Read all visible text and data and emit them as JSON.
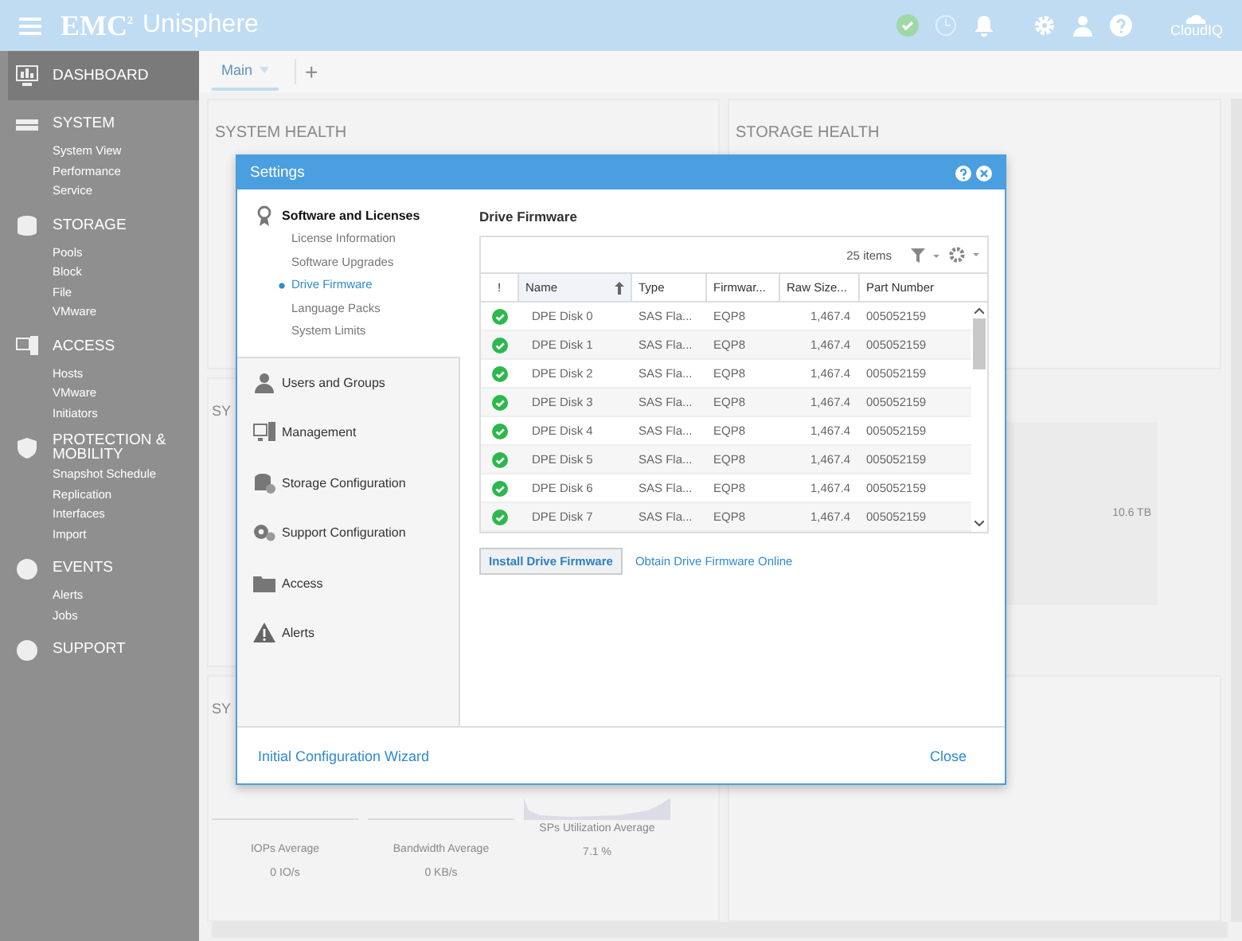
{
  "header": {
    "logo": "EMC$^{2}$",
    "product": "Unisphere",
    "cloud_label": "CloudIQ"
  },
  "sidebar": {
    "sections": [
      {
        "label": "DASHBOARD",
        "selected": true
      },
      {
        "label": "SYSTEM",
        "selected": false,
        "items": [
          "System View",
          "Performance",
          "Service"
        ]
      },
      {
        "label": "STORAGE",
        "selected": false,
        "items": [
          "Pools",
          "Block",
          "File",
          "VMware"
        ]
      },
      {
        "label": "ACCESS",
        "selected": false,
        "items": [
          "Hosts",
          "VMware",
          "Initiators"
        ]
      },
      {
        "label": "PROTECTION & MOBILITY",
        "selected": false,
        "items": [
          "Snapshot Schedule",
          "Replication",
          "Interfaces",
          "Import"
        ]
      },
      {
        "label": "EVENTS",
        "selected": false,
        "items": [
          "Alerts",
          "Jobs"
        ]
      },
      {
        "label": "SUPPORT",
        "selected": false
      }
    ]
  },
  "tabs": [
    {
      "label": "Main",
      "selected": true
    },
    {
      "label": "+",
      "selected": false
    }
  ],
  "dashboard": {
    "system_health": "SYSTEM HEALTH",
    "storage_health": "STORAGE HEALTH",
    "panel_2_title": "SY",
    "panel_3_title": "SY",
    "capacity_value": "10.6 TB",
    "stats": [
      {
        "label": "IOPs Average",
        "value": "0 IO/s"
      },
      {
        "label": "Bandwidth Average",
        "value": "0 KB/s"
      },
      {
        "label": "SPs Utilization Average",
        "value": "7.1 %"
      }
    ]
  },
  "dialog": {
    "title": "Settings",
    "nav": [
      {
        "label": "Software and Licenses",
        "expanded": true,
        "children": [
          {
            "label": "License Information",
            "selected": false
          },
          {
            "label": "Software Upgrades",
            "selected": false
          },
          {
            "label": "Drive Firmware",
            "selected": true
          },
          {
            "label": "Language Packs",
            "selected": false
          },
          {
            "label": "System Limits",
            "selected": false
          }
        ]
      },
      {
        "label": "Users and Groups",
        "expanded": false
      },
      {
        "label": "Management",
        "expanded": false
      },
      {
        "label": "Storage Configuration",
        "expanded": false
      },
      {
        "label": "Support Configuration",
        "expanded": false
      },
      {
        "label": "Access",
        "expanded": false
      },
      {
        "label": "Alerts",
        "expanded": false
      }
    ],
    "section_title": "Drive Firmware",
    "table": {
      "item_count": "25 items",
      "columns": [
        {
          "label": "!",
          "sorted": false
        },
        {
          "label": "Name",
          "sorted": true
        },
        {
          "label": "Type",
          "sorted": false
        },
        {
          "label": "Firmwar...",
          "sorted": false
        },
        {
          "label": "Raw Size...",
          "sorted": false
        },
        {
          "label": "Part Number",
          "sorted": false
        }
      ],
      "rows": [
        {
          "cells": [
            "",
            "DPE Disk 0",
            "SAS Fla...",
            "EQP8",
            "1,467.4",
            "005052159"
          ]
        },
        {
          "cells": [
            "",
            "DPE Disk 1",
            "SAS Fla...",
            "EQP8",
            "1,467.4",
            "005052159"
          ]
        },
        {
          "cells": [
            "",
            "DPE Disk 2",
            "SAS Fla...",
            "EQP8",
            "1,467.4",
            "005052159"
          ]
        },
        {
          "cells": [
            "",
            "DPE Disk 3",
            "SAS Fla...",
            "EQP8",
            "1,467.4",
            "005052159"
          ]
        },
        {
          "cells": [
            "",
            "DPE Disk 4",
            "SAS Fla...",
            "EQP8",
            "1,467.4",
            "005052159"
          ]
        },
        {
          "cells": [
            "",
            "DPE Disk 5",
            "SAS Fla...",
            "EQP8",
            "1,467.4",
            "005052159"
          ]
        },
        {
          "cells": [
            "",
            "DPE Disk 6",
            "SAS Fla...",
            "EQP8",
            "1,467.4",
            "005052159"
          ]
        },
        {
          "cells": [
            "",
            "DPE Disk 7",
            "SAS Fla...",
            "EQP8",
            "1,467.4",
            "005052159"
          ]
        }
      ]
    },
    "install_button": "Install Drive Firmware",
    "online_link": "Obtain Drive Firmware Online",
    "wizard_link": "Initial Configuration Wizard",
    "close_link": "Close"
  }
}
